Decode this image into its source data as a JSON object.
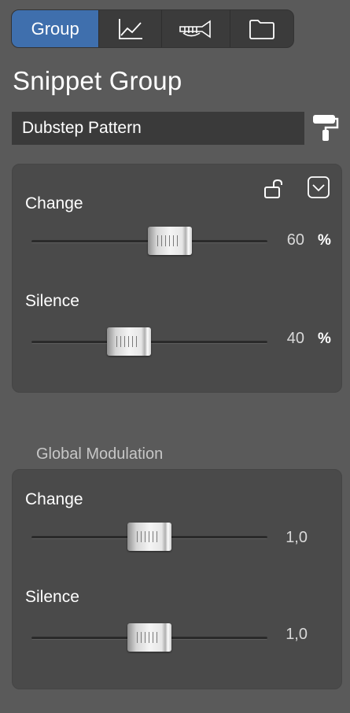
{
  "tabs": [
    {
      "label": "Group",
      "icon": "group-tab",
      "active": true
    },
    {
      "label": "",
      "icon": "chart-line-icon",
      "active": false
    },
    {
      "label": "",
      "icon": "trumpet-icon",
      "active": false
    },
    {
      "label": "",
      "icon": "folder-icon",
      "active": false
    }
  ],
  "title": "Snippet Group",
  "name_field": {
    "value": "Dubstep Pattern"
  },
  "panel1": {
    "rows": [
      {
        "label": "Change",
        "value": "60",
        "unit": "%",
        "level": 0.6
      },
      {
        "label": "Silence",
        "value": "40",
        "unit": "%",
        "level": 0.4
      }
    ]
  },
  "global_modulation": {
    "label": "Global Modulation",
    "rows": [
      {
        "label": "Change",
        "value": "1,0",
        "level": 0.5
      },
      {
        "label": "Silence",
        "value": "1,0",
        "level": 0.5
      }
    ]
  },
  "colors": {
    "accent": "#3f6fad",
    "background": "#5a5a5a",
    "panel": "#4a4a4a"
  }
}
